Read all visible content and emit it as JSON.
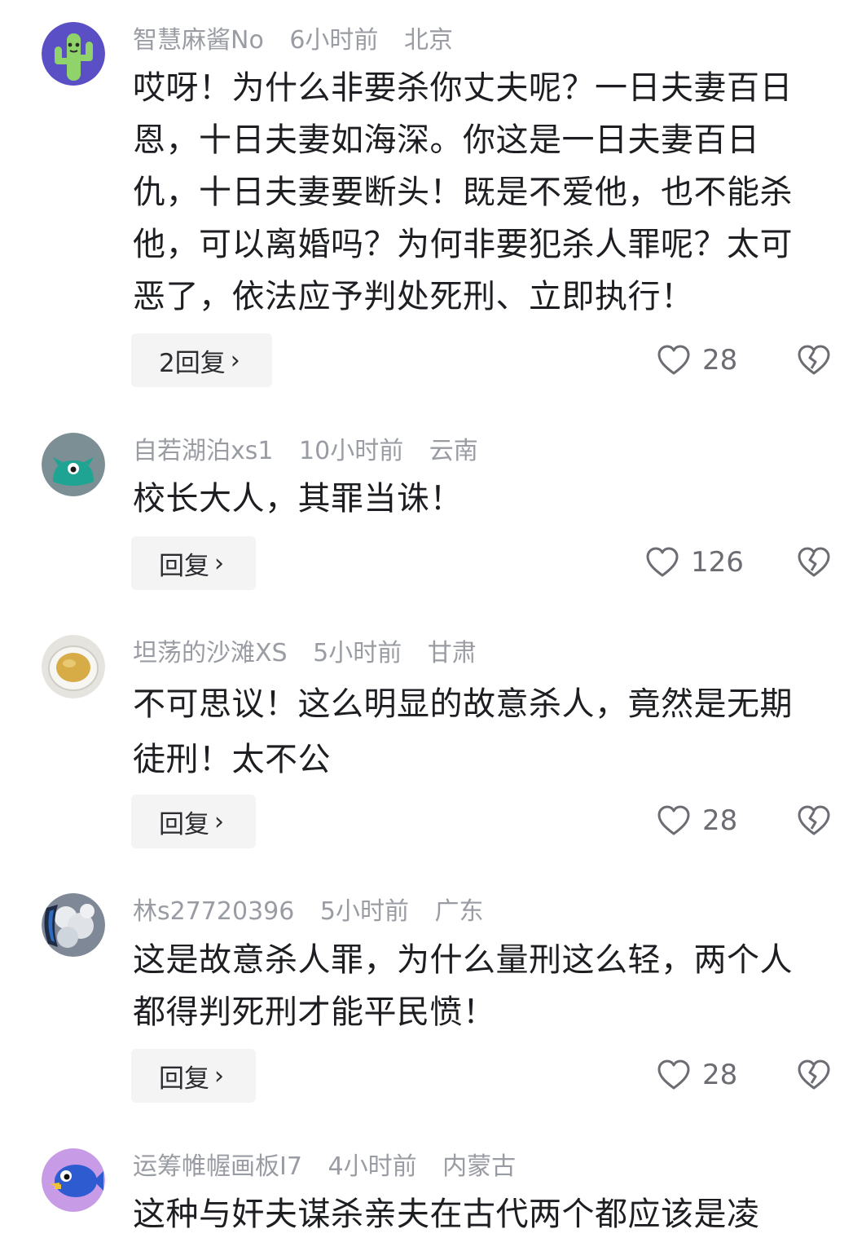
{
  "comments": [
    {
      "username": "智慧麻酱No",
      "time": "6小时前",
      "location": "北京",
      "text": "哎呀！为什么非要杀你丈夫呢？一日夫妻百日\n恩，十日夫妻如海深。你这是一日夫妻百日\n仇，十日夫妻要断头！既是不爱他，也不能杀\n他，可以离婚吗？为何非要犯杀人罪呢？太可\n恶了，依法应予判处死刑、立即执行！",
      "reply_label": "2回复",
      "likes": "28",
      "avatar_icon": "cactus-avatar-icon"
    },
    {
      "username": "自若湖泊xs1",
      "time": "10小时前",
      "location": "云南",
      "text": "校长大人，其罪当诛！",
      "reply_label": "回复",
      "likes": "126",
      "avatar_icon": "teal-creature-avatar-icon"
    },
    {
      "username": "坦荡的沙滩XS",
      "time": "5小时前",
      "location": "甘肃",
      "text": "不可思议！这么明显的故意杀人，竟然是无期\n徒刑！太不公",
      "reply_label": "回复",
      "likes": "28",
      "avatar_icon": "tea-cup-avatar-icon"
    },
    {
      "username": "林s27720396",
      "time": "5小时前",
      "location": "广东",
      "text": "这是故意杀人罪，为什么量刑这么轻，两个人\n都得判死刑才能平民愤！",
      "reply_label": "回复",
      "likes": "28",
      "avatar_icon": "airplane-window-avatar-icon"
    },
    {
      "username": "运筹帷幄画板I7",
      "time": "4小时前",
      "location": "内蒙古",
      "text": "这种与奸夫谋杀亲夫在古代两个都应该是凌",
      "avatar_icon": "blue-fish-avatar-icon"
    }
  ],
  "colors": {
    "meta": "#9a9ca3",
    "text": "#1d1e22",
    "reply_bg": "#f4f4f5",
    "icon": "#6b6d73"
  }
}
